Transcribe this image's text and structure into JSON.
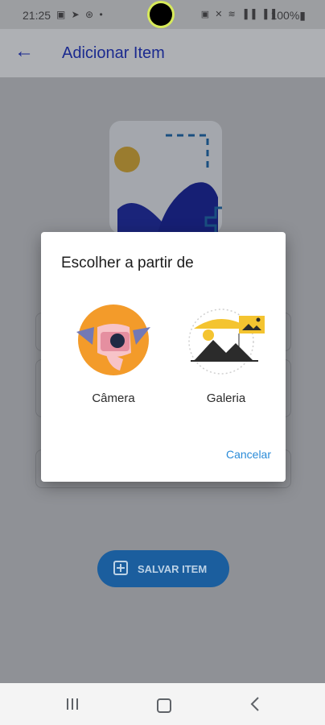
{
  "status_bar": {
    "time": "21:25",
    "left_icons": "▣ ➤ ⊛ •",
    "right_icons": "▣ ✕ ≋ ▐▐ ▐▐",
    "battery": "100%▮"
  },
  "app_bar": {
    "back_icon": "←",
    "title": "Adicionar Item"
  },
  "dialog": {
    "title": "Escolher a partir de",
    "options": [
      {
        "label": "Câmera",
        "icon": "camera-illustration"
      },
      {
        "label": "Galeria",
        "icon": "gallery-illustration"
      }
    ],
    "cancel_label": "Cancelar"
  },
  "save_button": {
    "label": "SALVAR ITEM"
  },
  "colors": {
    "primary": "#1b2a8f",
    "accent": "#2a8bd8",
    "overlay": "#8f9196"
  }
}
